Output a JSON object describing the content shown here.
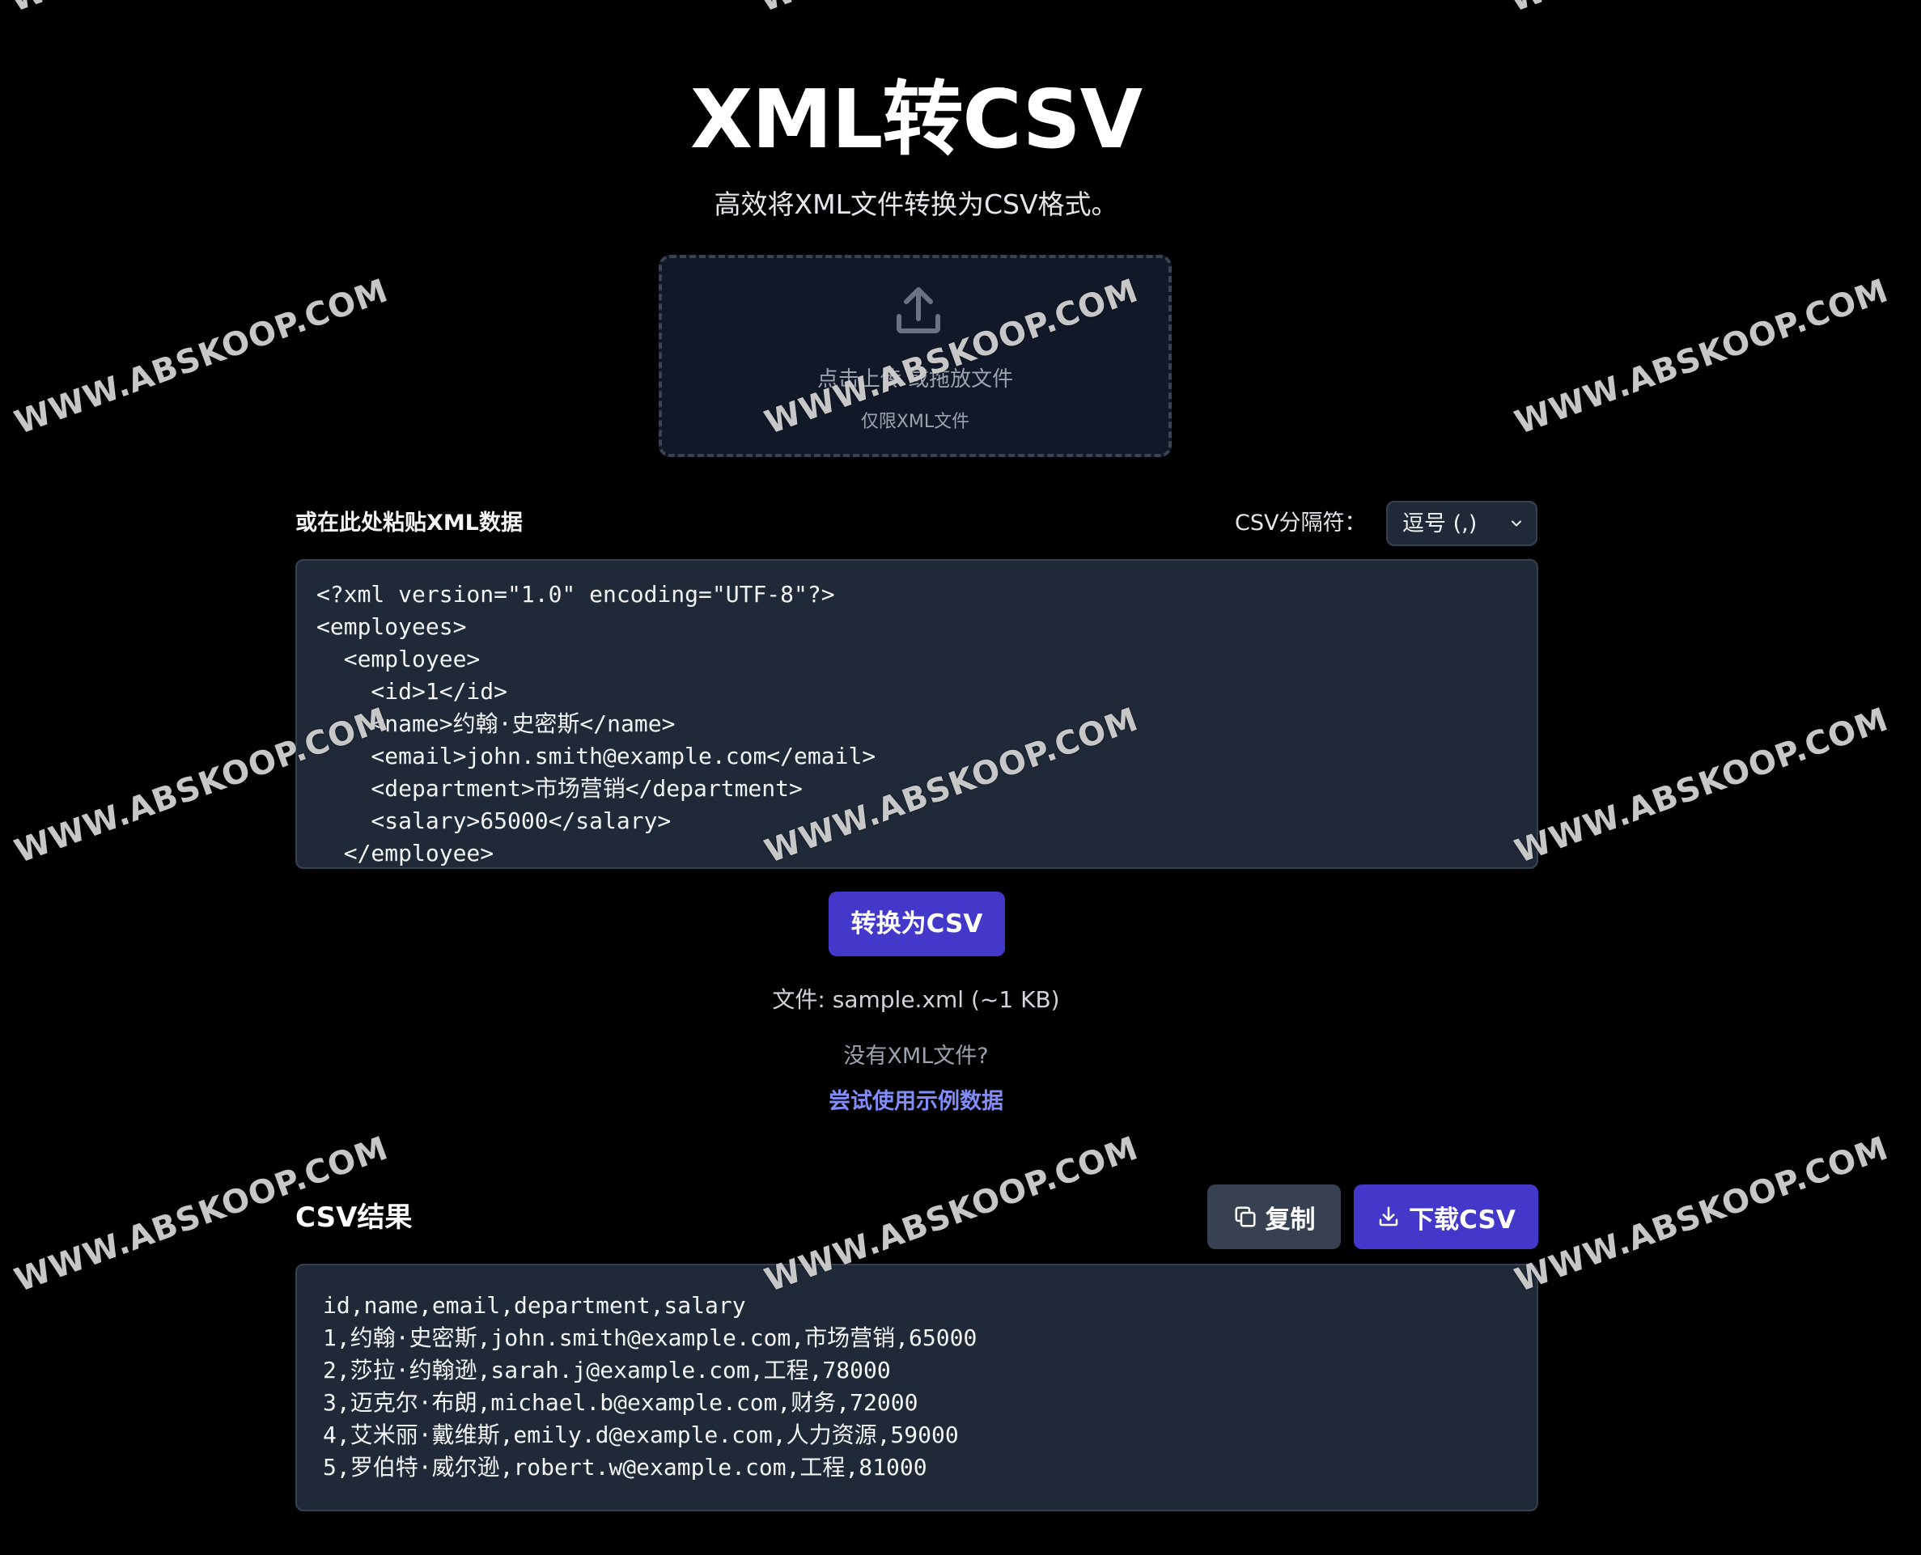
{
  "header": {
    "title": "XML转CSV",
    "subtitle": "高效将XML文件转换为CSV格式。"
  },
  "upload": {
    "main_text": "点击上传 或拖放文件",
    "hint": "仅限XML文件"
  },
  "input": {
    "label": "或在此处粘贴XML数据",
    "lines": [
      "<?xml version=\"1.0\" encoding=\"UTF-8\"?>",
      "<employees>",
      "  <employee>",
      "    <id>1</id>",
      "    <name>约翰·史密斯</name>",
      "    <email>john.smith@example.com</email>",
      "    <department>市场营销</department>",
      "    <salary>65000</salary>",
      "  </employee>"
    ]
  },
  "delimiter": {
    "label": "CSV分隔符：",
    "value": "逗号 (,)"
  },
  "actions": {
    "convert_label": "转换为CSV",
    "file_info": "文件: sample.xml (~1 KB)",
    "no_file_text": "没有XML文件?",
    "sample_link": "尝试使用示例数据"
  },
  "result": {
    "title": "CSV结果",
    "copy_label": "复制",
    "download_label": "下载CSV",
    "lines": [
      "id,name,email,department,salary",
      "1,约翰·史密斯,john.smith@example.com,市场营销,65000",
      "2,莎拉·约翰逊,sarah.j@example.com,工程,78000",
      "3,迈克尔·布朗,michael.b@example.com,财务,72000",
      "4,艾米丽·戴维斯,emily.d@example.com,人力资源,59000",
      "5,罗伯特·威尔逊,robert.w@example.com,工程,81000"
    ]
  },
  "watermark": {
    "text": "WWW.ABSKOOP.COM",
    "partial": "WW"
  },
  "colors": {
    "accent": "#4338ca",
    "link": "#818cf8",
    "panel": "#1f2937",
    "background": "#000000"
  },
  "icons": [
    "upload-icon",
    "chevron-down-icon",
    "copy-icon",
    "download-icon"
  ]
}
